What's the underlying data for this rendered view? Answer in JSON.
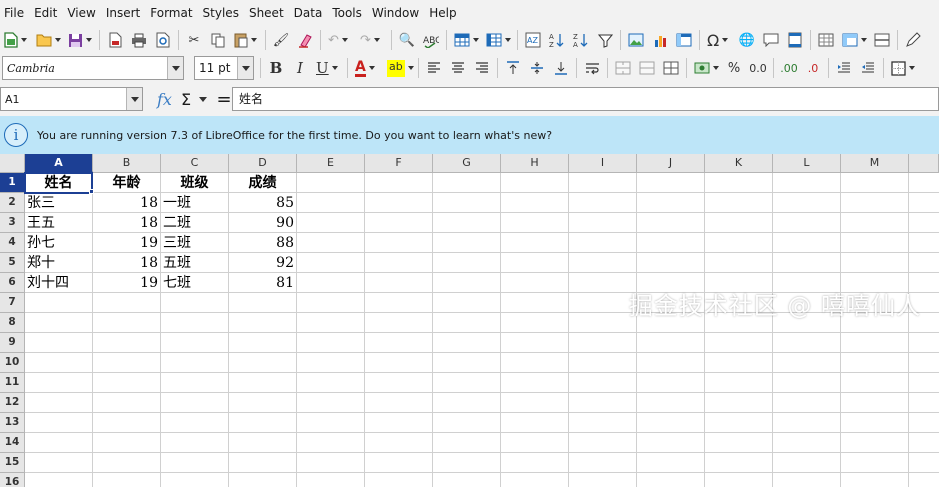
{
  "menu": [
    "File",
    "Edit",
    "View",
    "Insert",
    "Format",
    "Styles",
    "Sheet",
    "Data",
    "Tools",
    "Window",
    "Help"
  ],
  "toolbar": {
    "font_name": "Cambria",
    "font_size": "11 pt",
    "bold": "B",
    "italic": "I",
    "underline": "U",
    "font_color_glyph": "A",
    "highlight_glyph": "ab",
    "percent": "%",
    "decimal": "0.0",
    "add_decimal": ".00",
    "del_decimal": ".0"
  },
  "formula_bar": {
    "name_box": "A1",
    "fx": "fx",
    "sigma": "Σ",
    "equals": "=",
    "content": "姓名"
  },
  "infobar": {
    "icon": "i",
    "message": "You are running version 7.3 of LibreOffice for the first time. Do you want to learn what's new?"
  },
  "sheet": {
    "columns": [
      "A",
      "B",
      "C",
      "D",
      "E",
      "F",
      "G",
      "H",
      "I",
      "J",
      "K",
      "L",
      "M"
    ],
    "rows": [
      "1",
      "2",
      "3",
      "4",
      "5",
      "6",
      "7",
      "8",
      "9",
      "10",
      "11",
      "12",
      "13",
      "14",
      "15",
      "16"
    ],
    "header": [
      "姓名",
      "年龄",
      "班级",
      "成绩"
    ],
    "data": [
      [
        "张三",
        "18",
        "一班",
        "85"
      ],
      [
        "王五",
        "18",
        "二班",
        "90"
      ],
      [
        "孙七",
        "19",
        "三班",
        "88"
      ],
      [
        "郑十",
        "18",
        "五班",
        "92"
      ],
      [
        "刘十四",
        "19",
        "七班",
        "81"
      ]
    ]
  },
  "watermark": "掘金技术社区 @ 嘻嘻仙人"
}
